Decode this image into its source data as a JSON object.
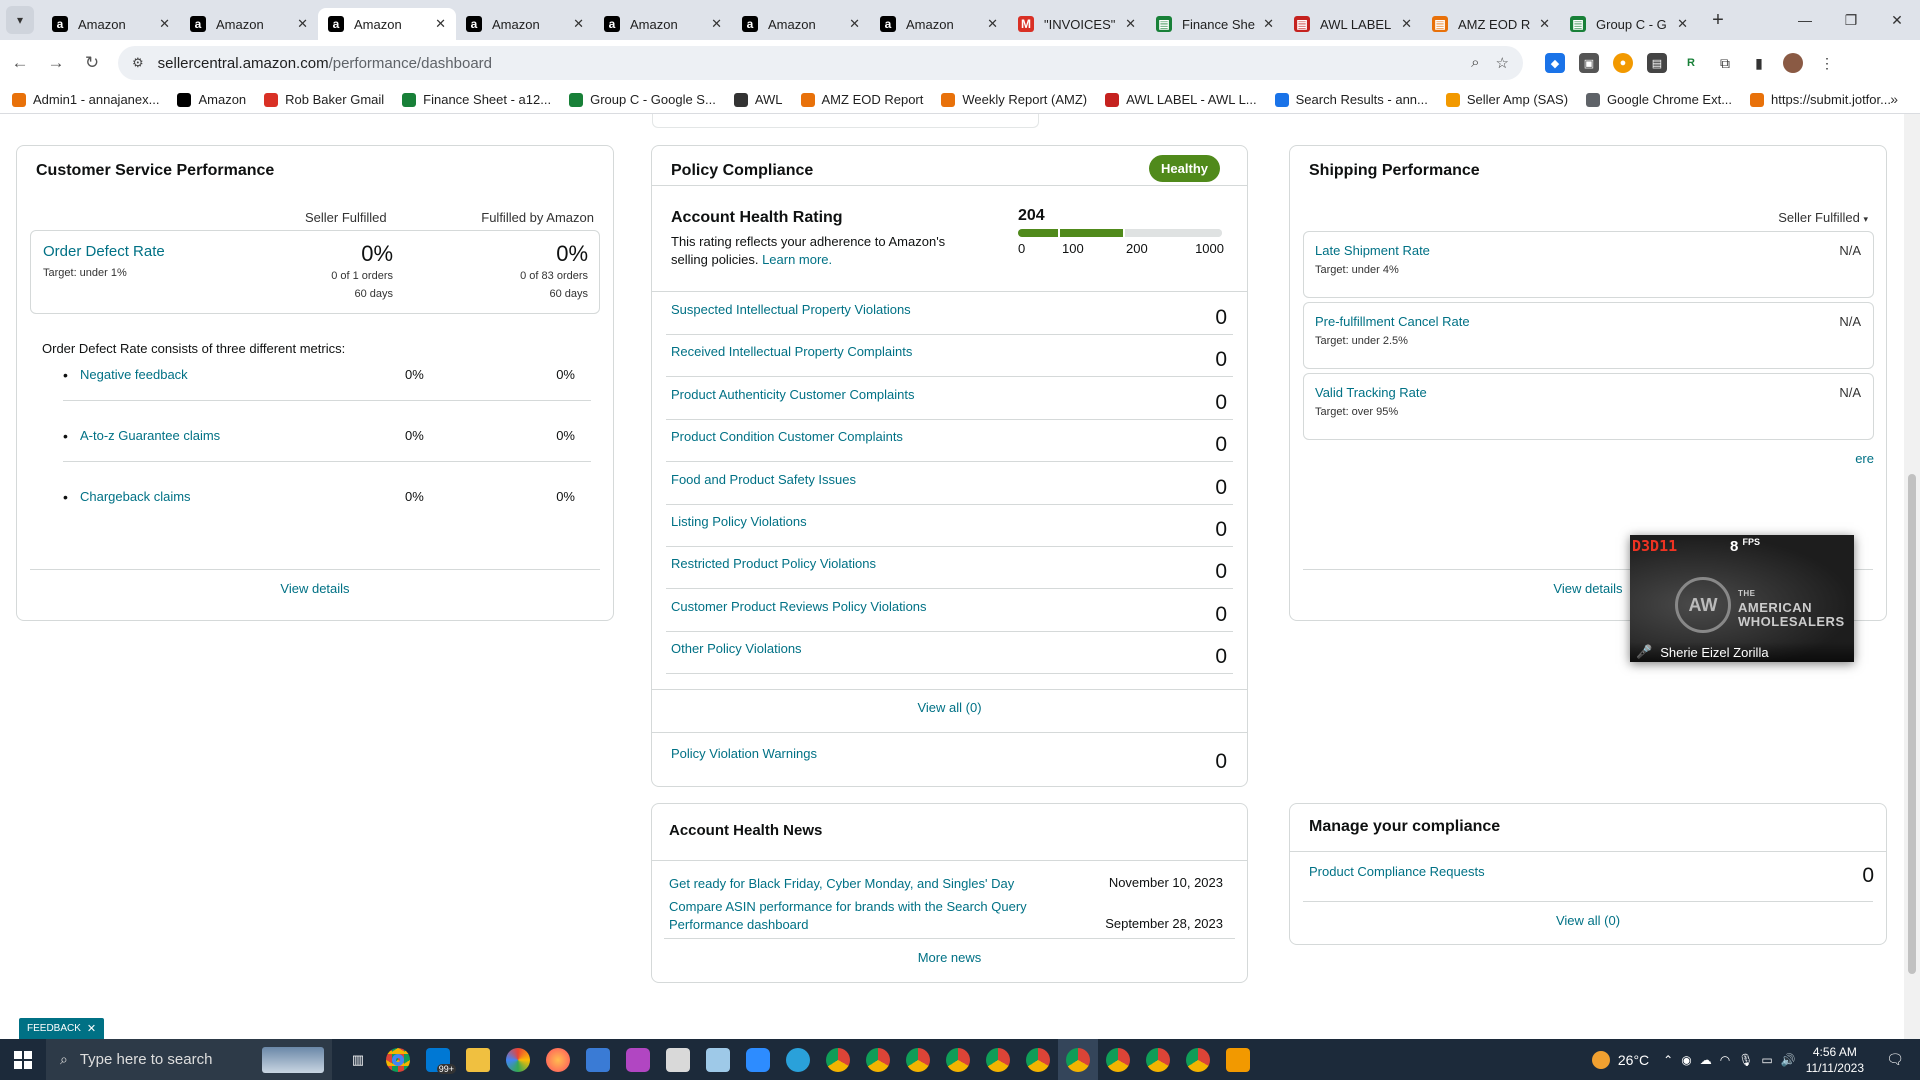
{
  "browser": {
    "tabs": [
      {
        "title": "Amazon",
        "icon": "amazon-icon",
        "color": "#000000"
      },
      {
        "title": "Amazon",
        "icon": "amazon-icon",
        "color": "#000000"
      },
      {
        "title": "Amazon",
        "icon": "amazon-icon",
        "color": "#000000",
        "active": true
      },
      {
        "title": "Amazon",
        "icon": "amazon-icon",
        "color": "#000000"
      },
      {
        "title": "Amazon",
        "icon": "amazon-icon",
        "color": "#000000"
      },
      {
        "title": "Amazon",
        "icon": "amazon-icon",
        "color": "#000000"
      },
      {
        "title": "Amazon",
        "icon": "amazon-icon",
        "color": "#000000"
      },
      {
        "title": "\"INVOICES\"",
        "icon": "gmail-icon",
        "color": "#d93025"
      },
      {
        "title": "Finance She",
        "icon": "sheets-icon",
        "color": "#188038"
      },
      {
        "title": "AWL LABEL",
        "icon": "awl-icon",
        "color": "#c5221f"
      },
      {
        "title": "AMZ EOD R",
        "icon": "report-icon",
        "color": "#e8710a"
      },
      {
        "title": "Group C - G",
        "icon": "sheets-icon",
        "color": "#188038"
      }
    ],
    "address": {
      "site": "sellercentral.amazon.com",
      "path": "/performance/dashboard"
    },
    "bookmarks": [
      {
        "label": "Admin1 - annajanex...",
        "color": "#e8710a"
      },
      {
        "label": "Amazon",
        "color": "#000000"
      },
      {
        "label": "Rob Baker Gmail",
        "color": "#d93025"
      },
      {
        "label": "Finance Sheet - a12...",
        "color": "#188038"
      },
      {
        "label": "Group C - Google S...",
        "color": "#188038"
      },
      {
        "label": "AWL",
        "color": "#333333"
      },
      {
        "label": "AMZ EOD Report",
        "color": "#e8710a"
      },
      {
        "label": "Weekly Report (AMZ)",
        "color": "#e8710a"
      },
      {
        "label": "AWL LABEL - AWL L...",
        "color": "#c5221f"
      },
      {
        "label": "Search Results - ann...",
        "color": "#1a73e8"
      },
      {
        "label": "Seller Amp (SAS)",
        "color": "#f29900"
      },
      {
        "label": "Google Chrome Ext...",
        "color": "#5f6368"
      },
      {
        "label": "https://submit.jotfor...",
        "color": "#e8710a"
      }
    ]
  },
  "csp": {
    "title": "Customer Service Performance",
    "col_seller": "Seller Fulfilled",
    "col_fba": "Fulfilled by Amazon",
    "odr": {
      "label": "Order Defect Rate",
      "target": "Target: under 1%",
      "seller_pct": "0%",
      "seller_orders": "0 of 1 orders",
      "seller_days": "60 days",
      "fba_pct": "0%",
      "fba_orders": "0 of 83 orders",
      "fba_days": "60 days"
    },
    "consists": "Order Defect Rate consists of three different metrics:",
    "metrics": [
      {
        "label": "Negative feedback",
        "seller": "0%",
        "fba": "0%"
      },
      {
        "label": "A-to-z Guarantee claims",
        "seller": "0%",
        "fba": "0%"
      },
      {
        "label": "Chargeback claims",
        "seller": "0%",
        "fba": "0%"
      }
    ],
    "view_details": "View details"
  },
  "policy": {
    "title": "Policy Compliance",
    "status": "Healthy",
    "status_color": "#508a1b",
    "ahr": {
      "title": "Account Health Rating",
      "desc": "This rating reflects your adherence to Amazon's selling policies.",
      "learn_more": "Learn more.",
      "score": "204",
      "scale": [
        "0",
        "100",
        "200",
        "1000"
      ]
    },
    "violations": [
      {
        "label": "Suspected Intellectual Property Violations",
        "count": "0"
      },
      {
        "label": "Received Intellectual Property Complaints",
        "count": "0"
      },
      {
        "label": "Product Authenticity Customer Complaints",
        "count": "0"
      },
      {
        "label": "Product Condition Customer Complaints",
        "count": "0"
      },
      {
        "label": "Food and Product Safety Issues",
        "count": "0"
      },
      {
        "label": "Listing Policy Violations",
        "count": "0"
      },
      {
        "label": "Restricted Product Policy Violations",
        "count": "0"
      },
      {
        "label": "Customer Product Reviews Policy Violations",
        "count": "0"
      },
      {
        "label": "Other Policy Violations",
        "count": "0"
      }
    ],
    "view_all": "View all (0)",
    "warnings": {
      "label": "Policy Violation Warnings",
      "count": "0"
    }
  },
  "shipping": {
    "title": "Shipping Performance",
    "selector": "Seller Fulfilled",
    "metrics": [
      {
        "label": "Late Shipment Rate",
        "target": "Target: under 4%",
        "value": "N/A"
      },
      {
        "label": "Pre-fulfillment Cancel Rate",
        "target": "Target: under 2.5%",
        "value": "N/A"
      },
      {
        "label": "Valid Tracking Rate",
        "target": "Target: over 95%",
        "value": "N/A"
      }
    ],
    "here": "ere",
    "view_details": "View details"
  },
  "video": {
    "d3d": "D3D11",
    "fps": "8",
    "fps_unit": "FPS",
    "brand_line1": "THE",
    "brand_line2": "AMERICAN",
    "brand_line3": "WHOLESALERS",
    "logo": "AW",
    "name": "Sherie Eizel Zorilla"
  },
  "news": {
    "title": "Account Health News",
    "items": [
      {
        "label": "Get ready for Black Friday, Cyber Monday, and Singles' Day",
        "date": "November 10, 2023"
      },
      {
        "label": "Compare ASIN performance for brands with the Search Query Performance dashboard",
        "date": "September 28, 2023"
      }
    ],
    "more": "More news"
  },
  "compliance": {
    "title": "Manage your compliance",
    "row": {
      "label": "Product Compliance Requests",
      "count": "0"
    },
    "view_all": "View all (0)"
  },
  "feedback": "FEEDBACK",
  "taskbar": {
    "search_placeholder": "Type here to search",
    "mail_badge": "99+",
    "temp": "26°C",
    "time": "4:56 AM",
    "date": "11/11/2023"
  }
}
